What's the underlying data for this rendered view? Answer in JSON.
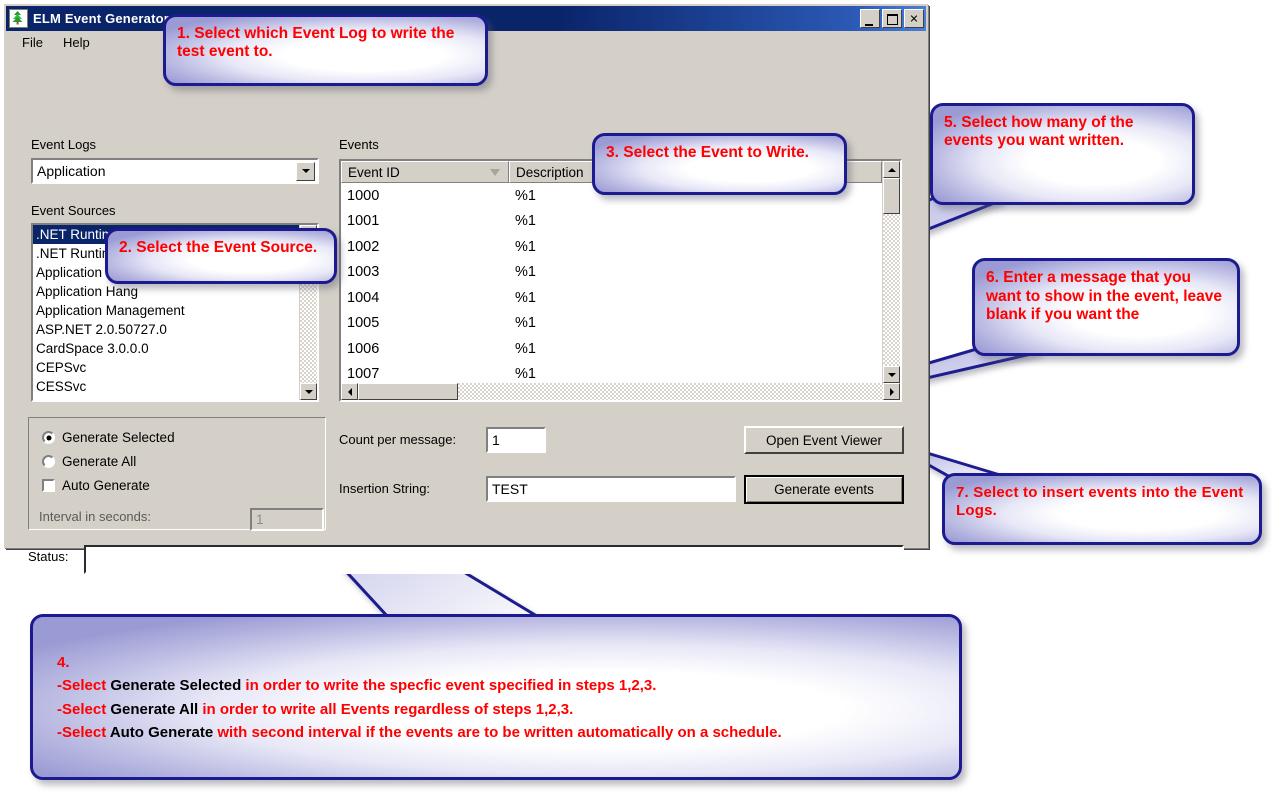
{
  "window": {
    "title": "ELM Event Generator",
    "icon": "tree-icon",
    "buttons": {
      "minimize": "minimize-icon",
      "maximize": "maximize-icon",
      "close": "close-icon"
    },
    "menu": [
      "File",
      "Help"
    ]
  },
  "form": {
    "event_logs_label": "Event Logs",
    "event_logs_value": "Application",
    "event_sources_label": "Event Sources",
    "event_sources": [
      {
        "label": ".NET Runtime",
        "selected": true
      },
      {
        "label": ".NET Runtime Optimization Service",
        "selected": false
      },
      {
        "label": "Application Error",
        "selected": false
      },
      {
        "label": "Application Hang",
        "selected": false
      },
      {
        "label": "Application Management",
        "selected": false
      },
      {
        "label": "ASP.NET 2.0.50727.0",
        "selected": false
      },
      {
        "label": "CardSpace 3.0.0.0",
        "selected": false
      },
      {
        "label": "CEPSvc",
        "selected": false
      },
      {
        "label": "CESSvc",
        "selected": false
      }
    ],
    "events_label": "Events",
    "events_columns": [
      "Event ID",
      "Description"
    ],
    "events_rows": [
      {
        "id": "1000",
        "description": "%1"
      },
      {
        "id": "1001",
        "description": "%1"
      },
      {
        "id": "1002",
        "description": "%1"
      },
      {
        "id": "1003",
        "description": "%1"
      },
      {
        "id": "1004",
        "description": "%1"
      },
      {
        "id": "1005",
        "description": "%1"
      },
      {
        "id": "1006",
        "description": "%1"
      },
      {
        "id": "1007",
        "description": "%1"
      }
    ],
    "generate_selected_label": "Generate Selected",
    "generate_all_label": "Generate All",
    "auto_generate_label": "Auto Generate",
    "interval_label": "Interval in seconds:",
    "interval_value": "1",
    "count_label": "Count per message:",
    "count_value": "1",
    "insertion_label": "Insertion String:",
    "insertion_value": "TEST",
    "open_viewer_label": "Open Event Viewer",
    "generate_events_label": "Generate events",
    "status_label": "Status:",
    "status_value": ""
  },
  "callouts": {
    "one": "1.  Select which Event Log to write the test event to.",
    "two": "2.  Select the Event Source.",
    "three": "3.  Select the Event to Write.",
    "five": "5.  Select how many of the events you want written.",
    "six": "6.  Enter a message that you want to show in the event, leave blank if you want the",
    "seven": "7.  Select to insert events into the Event Logs.",
    "four": {
      "number": "4.",
      "lines": [
        {
          "prefix": "-Select ",
          "bold": "Generate Selected",
          "rest": " in order to write the specfic event specified in steps 1,2,3."
        },
        {
          "prefix": "-Select ",
          "bold": "Generate All",
          "rest": " in order to write all Events regardless of steps 1,2,3."
        },
        {
          "prefix": "-Select ",
          "bold": "Auto Generate",
          "rest": " with second interval if the events are to be written automatically on a schedule."
        }
      ]
    }
  },
  "colors": {
    "titlebar": "#0a246a",
    "face": "#d4d0c8",
    "callout_border": "#1b1b8f",
    "callout_text": "#ff0000",
    "selection": "#0a246a"
  }
}
